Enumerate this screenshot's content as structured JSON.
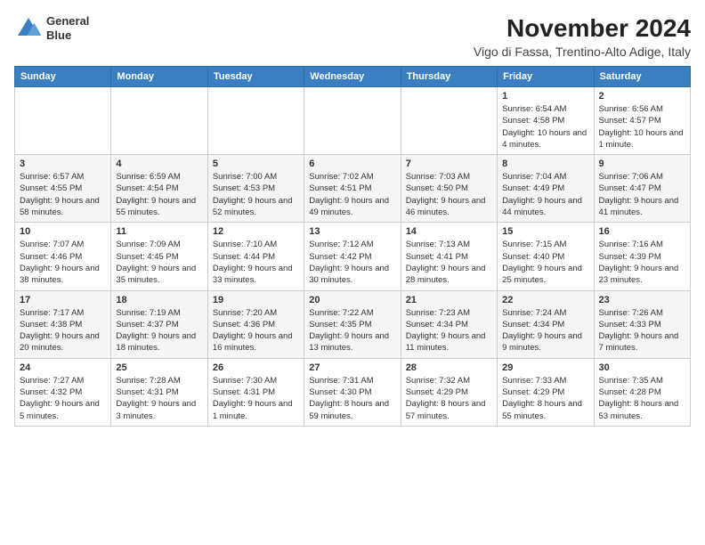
{
  "header": {
    "logo_line1": "General",
    "logo_line2": "Blue",
    "month": "November 2024",
    "location": "Vigo di Fassa, Trentino-Alto Adige, Italy"
  },
  "weekdays": [
    "Sunday",
    "Monday",
    "Tuesday",
    "Wednesday",
    "Thursday",
    "Friday",
    "Saturday"
  ],
  "weeks": [
    [
      {
        "day": "",
        "info": ""
      },
      {
        "day": "",
        "info": ""
      },
      {
        "day": "",
        "info": ""
      },
      {
        "day": "",
        "info": ""
      },
      {
        "day": "",
        "info": ""
      },
      {
        "day": "1",
        "info": "Sunrise: 6:54 AM\nSunset: 4:58 PM\nDaylight: 10 hours and 4 minutes."
      },
      {
        "day": "2",
        "info": "Sunrise: 6:56 AM\nSunset: 4:57 PM\nDaylight: 10 hours and 1 minute."
      }
    ],
    [
      {
        "day": "3",
        "info": "Sunrise: 6:57 AM\nSunset: 4:55 PM\nDaylight: 9 hours and 58 minutes."
      },
      {
        "day": "4",
        "info": "Sunrise: 6:59 AM\nSunset: 4:54 PM\nDaylight: 9 hours and 55 minutes."
      },
      {
        "day": "5",
        "info": "Sunrise: 7:00 AM\nSunset: 4:53 PM\nDaylight: 9 hours and 52 minutes."
      },
      {
        "day": "6",
        "info": "Sunrise: 7:02 AM\nSunset: 4:51 PM\nDaylight: 9 hours and 49 minutes."
      },
      {
        "day": "7",
        "info": "Sunrise: 7:03 AM\nSunset: 4:50 PM\nDaylight: 9 hours and 46 minutes."
      },
      {
        "day": "8",
        "info": "Sunrise: 7:04 AM\nSunset: 4:49 PM\nDaylight: 9 hours and 44 minutes."
      },
      {
        "day": "9",
        "info": "Sunrise: 7:06 AM\nSunset: 4:47 PM\nDaylight: 9 hours and 41 minutes."
      }
    ],
    [
      {
        "day": "10",
        "info": "Sunrise: 7:07 AM\nSunset: 4:46 PM\nDaylight: 9 hours and 38 minutes."
      },
      {
        "day": "11",
        "info": "Sunrise: 7:09 AM\nSunset: 4:45 PM\nDaylight: 9 hours and 35 minutes."
      },
      {
        "day": "12",
        "info": "Sunrise: 7:10 AM\nSunset: 4:44 PM\nDaylight: 9 hours and 33 minutes."
      },
      {
        "day": "13",
        "info": "Sunrise: 7:12 AM\nSunset: 4:42 PM\nDaylight: 9 hours and 30 minutes."
      },
      {
        "day": "14",
        "info": "Sunrise: 7:13 AM\nSunset: 4:41 PM\nDaylight: 9 hours and 28 minutes."
      },
      {
        "day": "15",
        "info": "Sunrise: 7:15 AM\nSunset: 4:40 PM\nDaylight: 9 hours and 25 minutes."
      },
      {
        "day": "16",
        "info": "Sunrise: 7:16 AM\nSunset: 4:39 PM\nDaylight: 9 hours and 23 minutes."
      }
    ],
    [
      {
        "day": "17",
        "info": "Sunrise: 7:17 AM\nSunset: 4:38 PM\nDaylight: 9 hours and 20 minutes."
      },
      {
        "day": "18",
        "info": "Sunrise: 7:19 AM\nSunset: 4:37 PM\nDaylight: 9 hours and 18 minutes."
      },
      {
        "day": "19",
        "info": "Sunrise: 7:20 AM\nSunset: 4:36 PM\nDaylight: 9 hours and 16 minutes."
      },
      {
        "day": "20",
        "info": "Sunrise: 7:22 AM\nSunset: 4:35 PM\nDaylight: 9 hours and 13 minutes."
      },
      {
        "day": "21",
        "info": "Sunrise: 7:23 AM\nSunset: 4:34 PM\nDaylight: 9 hours and 11 minutes."
      },
      {
        "day": "22",
        "info": "Sunrise: 7:24 AM\nSunset: 4:34 PM\nDaylight: 9 hours and 9 minutes."
      },
      {
        "day": "23",
        "info": "Sunrise: 7:26 AM\nSunset: 4:33 PM\nDaylight: 9 hours and 7 minutes."
      }
    ],
    [
      {
        "day": "24",
        "info": "Sunrise: 7:27 AM\nSunset: 4:32 PM\nDaylight: 9 hours and 5 minutes."
      },
      {
        "day": "25",
        "info": "Sunrise: 7:28 AM\nSunset: 4:31 PM\nDaylight: 9 hours and 3 minutes."
      },
      {
        "day": "26",
        "info": "Sunrise: 7:30 AM\nSunset: 4:31 PM\nDaylight: 9 hours and 1 minute."
      },
      {
        "day": "27",
        "info": "Sunrise: 7:31 AM\nSunset: 4:30 PM\nDaylight: 8 hours and 59 minutes."
      },
      {
        "day": "28",
        "info": "Sunrise: 7:32 AM\nSunset: 4:29 PM\nDaylight: 8 hours and 57 minutes."
      },
      {
        "day": "29",
        "info": "Sunrise: 7:33 AM\nSunset: 4:29 PM\nDaylight: 8 hours and 55 minutes."
      },
      {
        "day": "30",
        "info": "Sunrise: 7:35 AM\nSunset: 4:28 PM\nDaylight: 8 hours and 53 minutes."
      }
    ]
  ]
}
